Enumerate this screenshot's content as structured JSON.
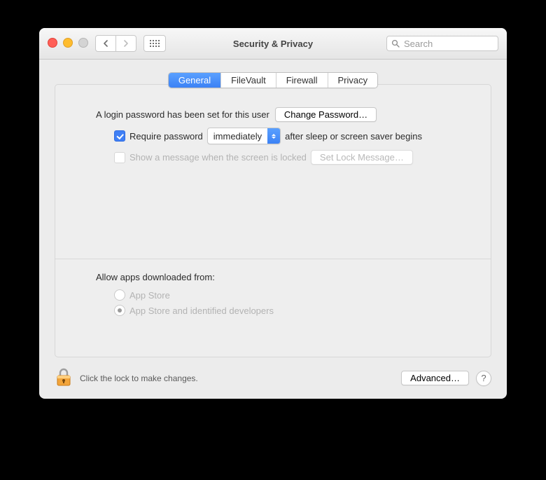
{
  "window": {
    "title": "Security & Privacy",
    "search_placeholder": "Search"
  },
  "tabs": {
    "general": "General",
    "filevault": "FileVault",
    "firewall": "Firewall",
    "privacy": "Privacy"
  },
  "login": {
    "text": "A login password has been set for this user",
    "change_btn": "Change Password…",
    "require_label": "Require password",
    "delay_value": "immediately",
    "after_text": "after sleep or screen saver begins",
    "show_message_label": "Show a message when the screen is locked",
    "set_lock_btn": "Set Lock Message…"
  },
  "download": {
    "heading": "Allow apps downloaded from:",
    "option1": "App Store",
    "option2": "App Store and identified developers"
  },
  "footer": {
    "lock_text": "Click the lock to make changes.",
    "advanced_btn": "Advanced…",
    "help": "?"
  }
}
